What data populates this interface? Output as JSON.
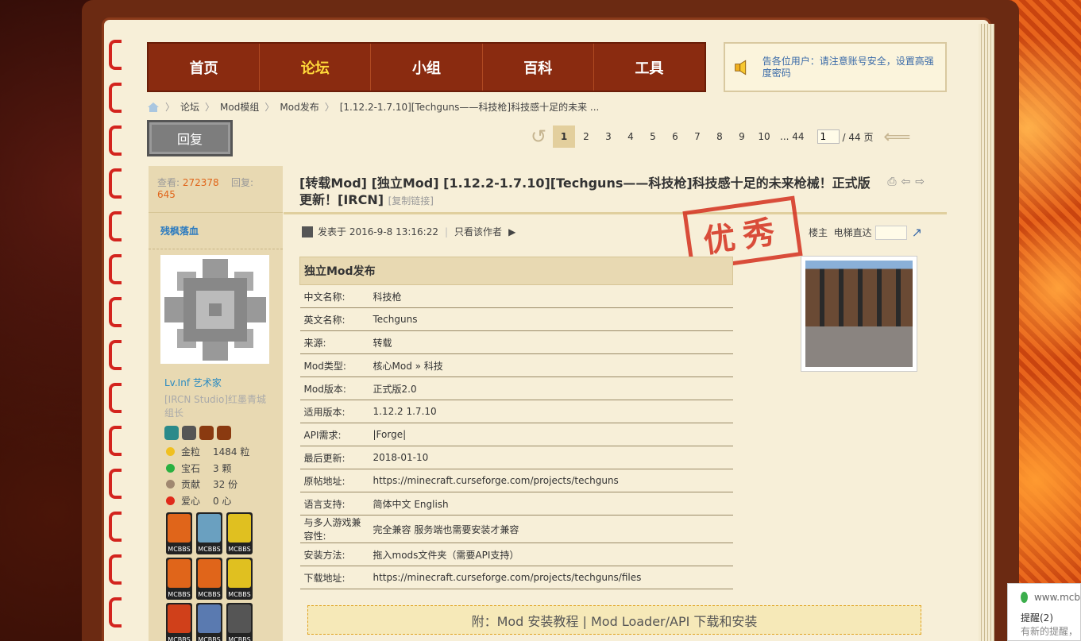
{
  "nav": {
    "items": [
      {
        "label": "首页"
      },
      {
        "label": "论坛",
        "active": true
      },
      {
        "label": "小组"
      },
      {
        "label": "百科"
      },
      {
        "label": "工具"
      }
    ]
  },
  "notice": {
    "text": "告各位用户：请注意账号安全，设置高强度密码"
  },
  "breadcrumb": {
    "items": [
      "论坛",
      "Mod模组",
      "Mod发布",
      "[1.12.2-1.7.10][Techguns——科技枪]科技感十足的未来 ..."
    ]
  },
  "reply_button": "回复",
  "pager": {
    "pages": [
      "1",
      "2",
      "3",
      "4",
      "5",
      "6",
      "7",
      "8",
      "9",
      "10",
      "... 44"
    ],
    "current": "1",
    "input_value": "1",
    "total": "/ 44 页"
  },
  "sidebar": {
    "views_label": "查看:",
    "views": "272378",
    "replies_label": "回复:",
    "replies": "645",
    "username": "残枫落血",
    "level": "Lv.Inf 艺术家",
    "group": "[IRCN Studio]红墨青城组长",
    "stats": [
      {
        "k": "金粒",
        "v": "1484 粒",
        "color": "#f0c020"
      },
      {
        "k": "宝石",
        "v": "3 颗",
        "color": "#2ab040"
      },
      {
        "k": "贡献",
        "v": "32 份",
        "color": "#a08870"
      },
      {
        "k": "爱心",
        "v": "0 心",
        "color": "#e02a1a"
      }
    ],
    "medal_label": "MCBBS",
    "medals": [
      "#e0651a",
      "#6aa0c0",
      "#e0c020",
      "#e0651a",
      "#e0651a",
      "#e0c020",
      "#d0401a",
      "#5a7ab0",
      "#555555"
    ]
  },
  "post": {
    "title": "[转载Mod] [独立Mod] [1.12.2-1.7.10][Techguns——科技枪]科技感十足的未来枪械！正式版更新！[IRCN]",
    "copy_link": "[复制链接]",
    "posted": "发表于 2016-9-8 13:16:22",
    "author_only": "只看该作者",
    "stamp": "优秀",
    "floor": "楼主",
    "jump": "电梯直达"
  },
  "mod_table": {
    "header": "独立Mod发布",
    "rows": [
      {
        "k": "中文名称:",
        "v": "科技枪"
      },
      {
        "k": "英文名称:",
        "v": "Techguns"
      },
      {
        "k": "来源:",
        "v": "转载"
      },
      {
        "k": "Mod类型:",
        "v": "核心Mod » 科技"
      },
      {
        "k": "Mod版本:",
        "v": "正式版2.0"
      },
      {
        "k": "适用版本:",
        "v": "1.12.2 1.7.10"
      },
      {
        "k": "API需求:",
        "v": "|Forge|"
      },
      {
        "k": "最后更新:",
        "v": "2018-01-10"
      },
      {
        "k": "原帖地址:",
        "v": "https://minecraft.curseforge.com/projects/techguns"
      },
      {
        "k": "语言支持:",
        "v": "简体中文 English"
      },
      {
        "k": "与多人游戏兼容性:",
        "v": "完全兼容 服务端也需要安装才兼容"
      },
      {
        "k": "安装方法:",
        "v": "拖入mods文件夹（需要API支持）"
      },
      {
        "k": "下载地址:",
        "v": "https://minecraft.curseforge.com/projects/techguns/files"
      }
    ]
  },
  "attachment": "附：Mod 安装教程 | Mod Loader/API 下载和安装",
  "toast": {
    "url": "www.mcb",
    "title": "提醒(2)",
    "sub": "有新的提醒，"
  }
}
